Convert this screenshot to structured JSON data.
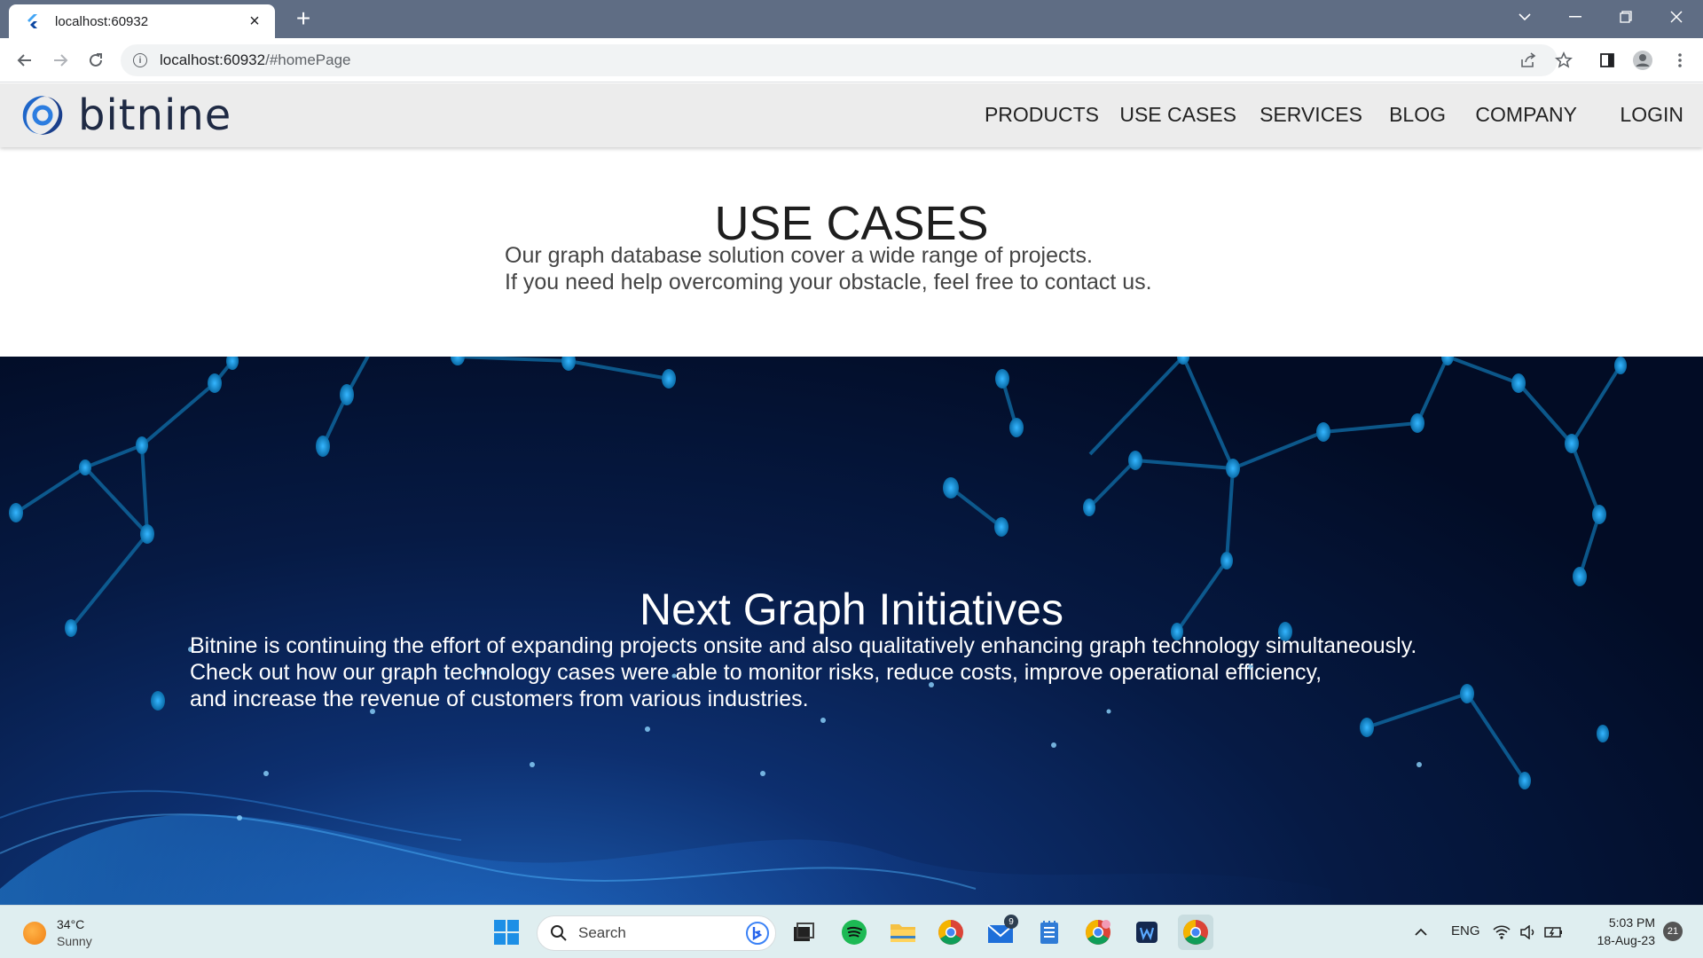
{
  "browser": {
    "tab_title": "localhost:60932",
    "url_host": "localhost:60932",
    "url_path": "/#homePage"
  },
  "site": {
    "logo_text": "bitnine",
    "nav": [
      "PRODUCTS",
      "USE CASES",
      "SERVICES",
      "BLOG",
      "COMPANY"
    ],
    "login": "LOGIN"
  },
  "use_cases": {
    "title": "USE CASES",
    "lines": [
      "Our graph database solution cover a wide range of projects.",
      "If you need help overcoming your obstacle, feel free to contact us."
    ]
  },
  "initiatives": {
    "title": "Next Graph Initiatives",
    "lines": [
      "Bitnine is continuing the effort of expanding projects onsite and also qualitatively enhancing graph technology simultaneously.",
      " Check out how our graph technology cases were able to monitor risks, reduce costs, improve operational efficiency,",
      " and increase the revenue of customers from various industries."
    ]
  },
  "taskbar": {
    "weather_temp": "34°C",
    "weather_cond": "Sunny",
    "search_placeholder": "Search",
    "mail_badge": "9",
    "lang": "ENG",
    "time": "5:03 PM",
    "date": "18-Aug-23",
    "notifications": "21"
  },
  "colors": {
    "tabstrip": "#5f6d84",
    "header_bg": "#ececec",
    "hero_dark": "#020c25",
    "node": "#1a9ad6"
  }
}
